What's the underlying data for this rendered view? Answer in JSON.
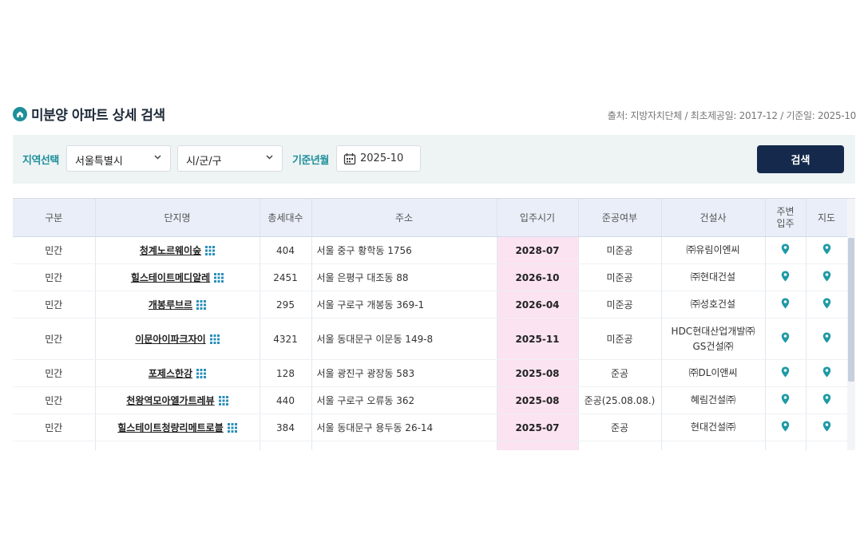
{
  "header": {
    "title": "미분양 아파트 상세 검색",
    "source": "출처: 지방자치단체 / 최초제공일: 2017-12 / 기준일: 2025-10"
  },
  "filters": {
    "region_label": "지역선택",
    "region_value": "서울특별시",
    "district_value": "시/군/구",
    "date_label": "기준년월",
    "date_value": "2025-10",
    "search_label": "검색"
  },
  "table": {
    "headers": [
      "구분",
      "단지명",
      "총세대수",
      "주소",
      "입주시기",
      "준공여부",
      "건설사",
      "주변\n입주",
      "지도"
    ],
    "rows": [
      {
        "type": "민간",
        "name": "청계노르웨이숲",
        "units": "404",
        "address": "서울 중구 황학동 1756",
        "move_in": "2028-07",
        "completion": "미준공",
        "builder": "㈜유림이엔씨"
      },
      {
        "type": "민간",
        "name": "힐스테이트메디알레",
        "units": "2451",
        "address": "서울 은평구 대조동 88",
        "move_in": "2026-10",
        "completion": "미준공",
        "builder": "㈜현대건설"
      },
      {
        "type": "민간",
        "name": "개봉루브르",
        "units": "295",
        "address": "서울 구로구 개봉동 369-1",
        "move_in": "2026-04",
        "completion": "미준공",
        "builder": "㈜성호건설"
      },
      {
        "type": "민간",
        "name": "이문아이파크자이",
        "units": "4321",
        "address": "서울 동대문구 이문동 149-8",
        "move_in": "2025-11",
        "completion": "미준공",
        "builder": "HDC현대산업개발㈜\nGS건설㈜"
      },
      {
        "type": "민간",
        "name": "포제스한강",
        "units": "128",
        "address": "서울 광진구 광장동 583",
        "move_in": "2025-08",
        "completion": "준공",
        "builder": "㈜DL이앤씨"
      },
      {
        "type": "민간",
        "name": "천왕역모아엘가트레뷰",
        "units": "440",
        "address": "서울 구로구 오류동 362",
        "move_in": "2025-08",
        "completion": "준공(25.08.08.)",
        "builder": "혜림건설㈜"
      },
      {
        "type": "민간",
        "name": "힐스테이트청량리메트로블",
        "units": "384",
        "address": "서울 동대문구 용두동 26-14",
        "move_in": "2025-07",
        "completion": "준공",
        "builder": "현대건설㈜"
      }
    ]
  },
  "icons": {
    "title": "home-icon",
    "chevron": "chevron-down-icon",
    "date": "calendar-icon",
    "grid": "grid-icon",
    "pin": "map-pin-icon"
  },
  "colors": {
    "accent": "#1e8f9a",
    "button": "#14294b",
    "header_bg": "#e9eef8",
    "highlight": "#fbe3f1",
    "filter_bg": "#eef4f4"
  }
}
